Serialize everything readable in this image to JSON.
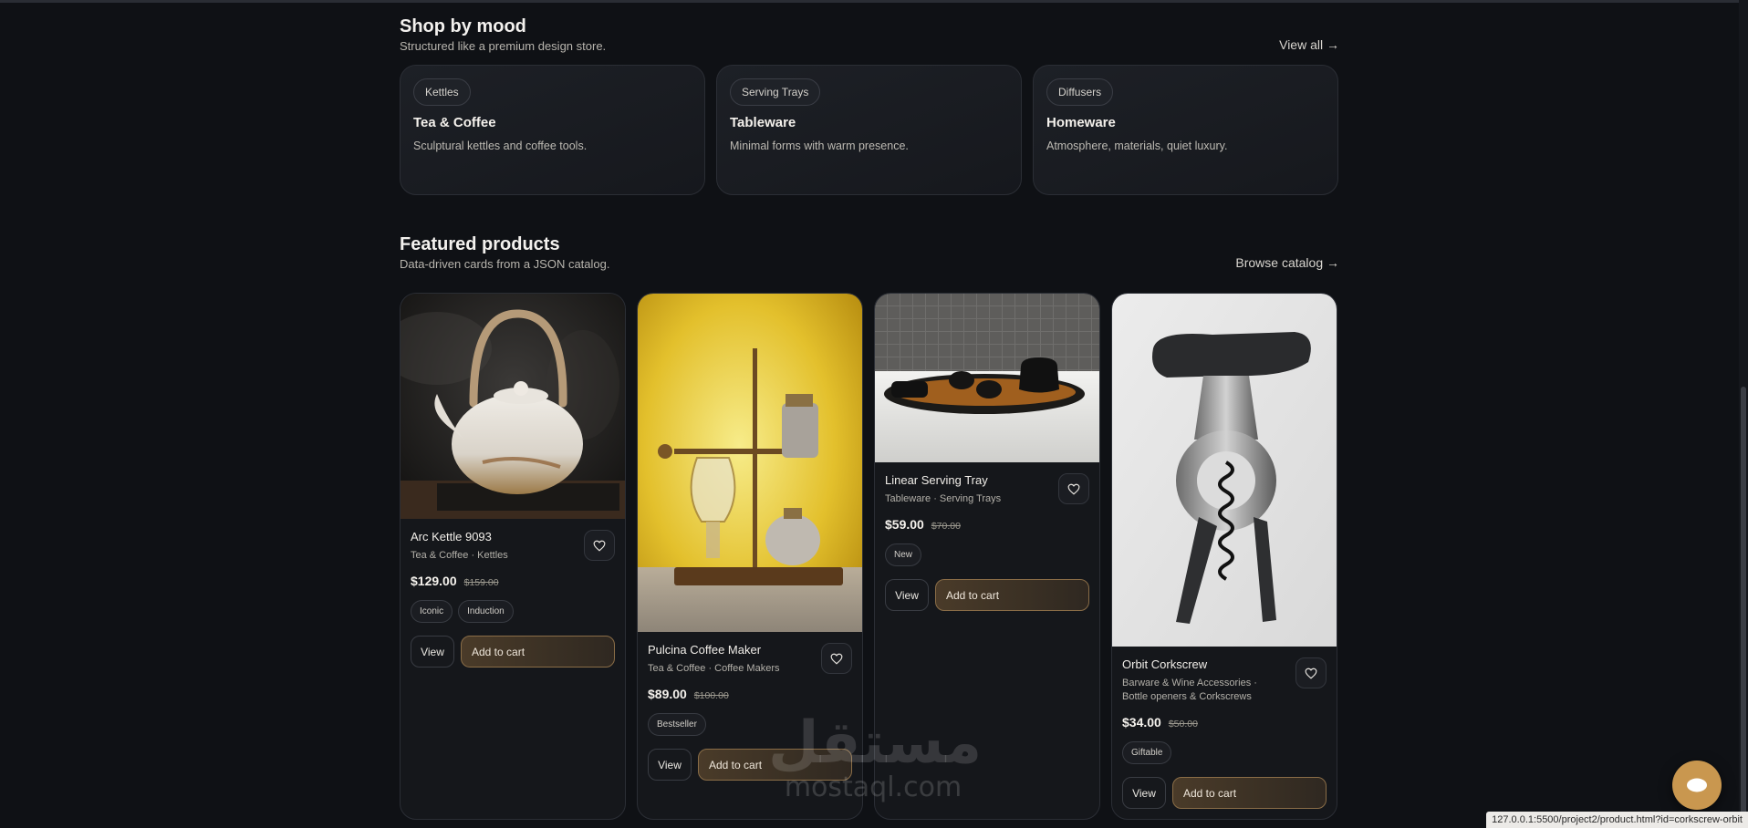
{
  "mood": {
    "title": "Shop by mood",
    "subtitle": "Structured like a premium design store.",
    "link": "View all →",
    "cards": [
      {
        "tag": "Kettles",
        "name": "Tea & Coffee",
        "desc": "Sculptural kettles and coffee tools."
      },
      {
        "tag": "Serving Trays",
        "name": "Tableware",
        "desc": "Minimal forms with warm presence."
      },
      {
        "tag": "Diffusers",
        "name": "Homeware",
        "desc": "Atmosphere, materials, quiet luxury."
      }
    ]
  },
  "featured": {
    "title": "Featured products",
    "subtitle": "Data-driven cards from a JSON catalog.",
    "link": "Browse catalog →",
    "view_label": "View",
    "cart_label": "Add to cart",
    "products": [
      {
        "name": "Arc Kettle 9093",
        "category": "Tea & Coffee · Kettles",
        "price": "$129.00",
        "old_price": "$159.00",
        "tags": [
          "Iconic",
          "Induction"
        ],
        "image": "white-teapot-photo"
      },
      {
        "name": "Pulcina Coffee Maker",
        "category": "Tea & Coffee · Coffee Makers",
        "price": "$89.00",
        "old_price": "$100.00",
        "tags": [
          "Bestseller"
        ],
        "image": "brass-siphon-coffee-maker-photo"
      },
      {
        "name": "Linear Serving Tray",
        "category": "Tableware · Serving Trays",
        "price": "$59.00",
        "old_price": "$70.00",
        "tags": [
          "New"
        ],
        "image": "tea-set-on-tray-photo"
      },
      {
        "name": "Orbit Corkscrew",
        "category": "Barware & Wine Accessories · Bottle openers & Corkscrews",
        "price": "$34.00",
        "old_price": "$50.00",
        "tags": [
          "Giftable"
        ],
        "image": "corkscrew-photo"
      }
    ]
  },
  "watermark": {
    "arabic": "مستقل",
    "latin": "mostaql.com"
  },
  "status_bar": {
    "url": "127.0.0.1:5500/project2/product.html?id=corkscrew-orbit"
  },
  "colors": {
    "background": "#0f1115",
    "card": "#15171b",
    "accent": "#c9974f",
    "cart_border": "#8a6d47"
  }
}
